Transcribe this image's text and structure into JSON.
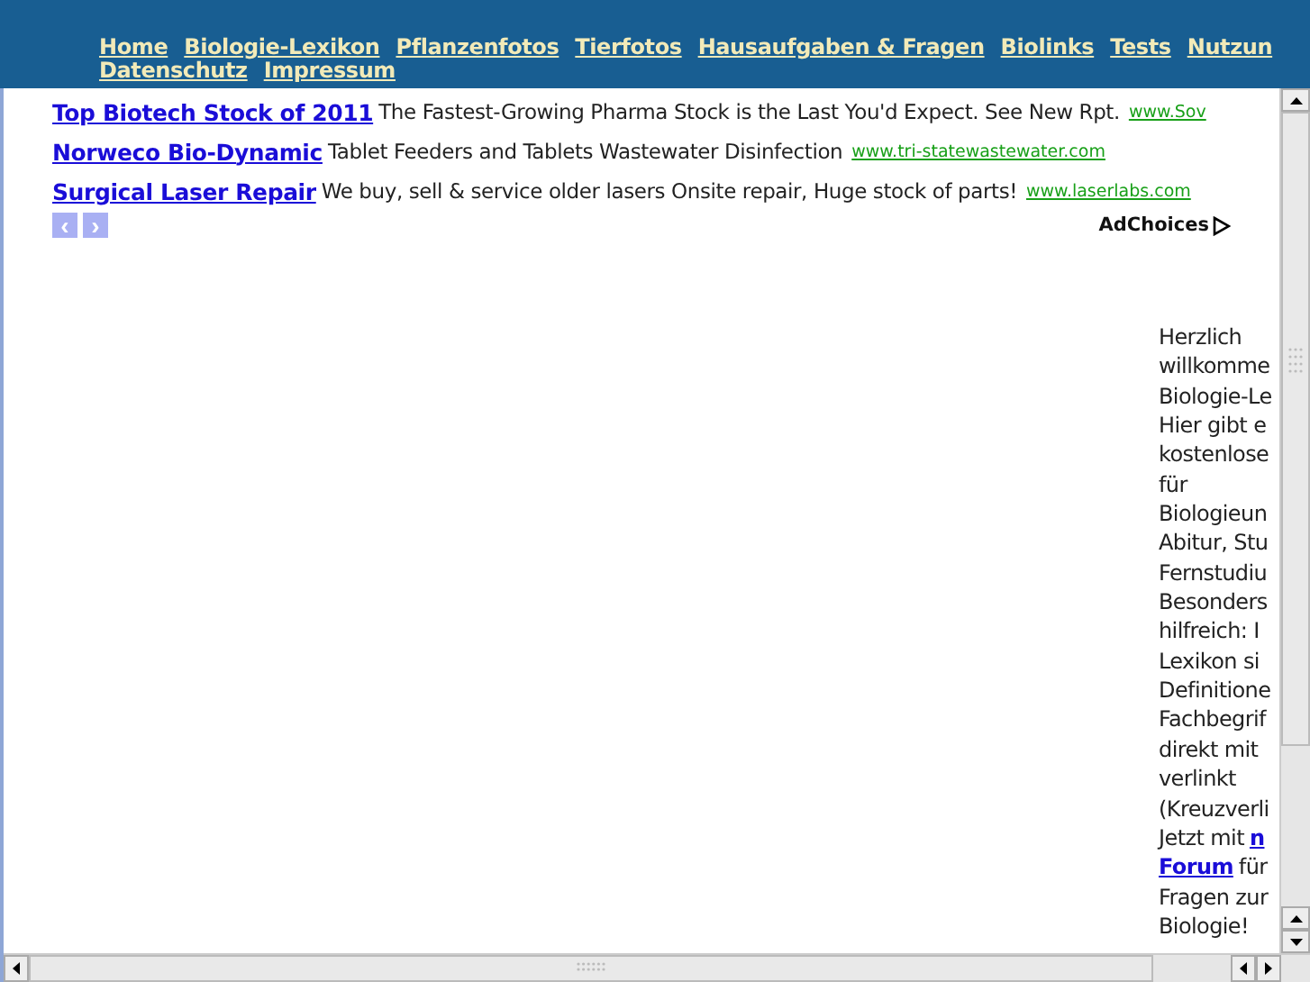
{
  "nav": {
    "items": [
      "Home",
      "Biologie-Lexikon",
      "Pflanzenfotos",
      "Tierfotos",
      "Hausaufgaben & Fragen",
      "Biolinks",
      "Tests",
      "Nutzun"
    ],
    "second_row": [
      "Datenschutz",
      "Impressum"
    ]
  },
  "ads": [
    {
      "title": "Top Biotech Stock of 2011",
      "text": "The Fastest-Growing Pharma Stock is the Last You'd Expect. See New Rpt.",
      "url": "www.Sov"
    },
    {
      "title": "Norweco Bio-Dynamic",
      "text": "Tablet Feeders and Tablets Wastewater Disinfection",
      "url": "www.tri-statewastewater.com"
    },
    {
      "title": "Surgical Laser Repair",
      "text": "We buy, sell & service older lasers Onsite repair, Huge stock of parts!",
      "url": "www.laserlabs.com"
    }
  ],
  "ad_nav": [
    "‹",
    "›"
  ],
  "adchoices": "AdChoices",
  "intro": [
    [
      {
        "text": "Herzlich",
        "link": false
      }
    ],
    [
      {
        "text": "willkomme",
        "link": false
      }
    ],
    [
      {
        "text": "Biologie-Le",
        "link": false
      }
    ],
    [
      {
        "text": "Hier gibt e",
        "link": false
      }
    ],
    [
      {
        "text": "kostenlose",
        "link": false
      }
    ],
    [
      {
        "text": "für",
        "link": false
      }
    ],
    [
      {
        "text": "Biologieun",
        "link": false
      }
    ],
    [
      {
        "text": "Abitur, Stu",
        "link": false
      }
    ],
    [
      {
        "text": "Fernstudiu",
        "link": false
      }
    ],
    [
      {
        "text": "Besonders",
        "link": false
      }
    ],
    [
      {
        "text": "hilfreich: I",
        "link": false
      }
    ],
    [
      {
        "text": "Lexikon si",
        "link": false
      }
    ],
    [
      {
        "text": "Definitione",
        "link": false
      }
    ],
    [
      {
        "text": "Fachbegrif",
        "link": false
      }
    ],
    [
      {
        "text": "direkt mit",
        "link": false
      }
    ],
    [
      {
        "text": "verlinkt",
        "link": false
      }
    ],
    [
      {
        "text": "(Kreuzverli",
        "link": false
      }
    ],
    [
      {
        "text": "Jetzt mit",
        "link": false
      },
      {
        "text": "n",
        "link": true
      }
    ],
    [
      {
        "text": "Forum",
        "link": true
      },
      {
        "text": "für",
        "link": false
      }
    ],
    [
      {
        "text": "Fragen zur",
        "link": false
      }
    ],
    [
      {
        "text": "Biologie!",
        "link": false
      }
    ]
  ]
}
